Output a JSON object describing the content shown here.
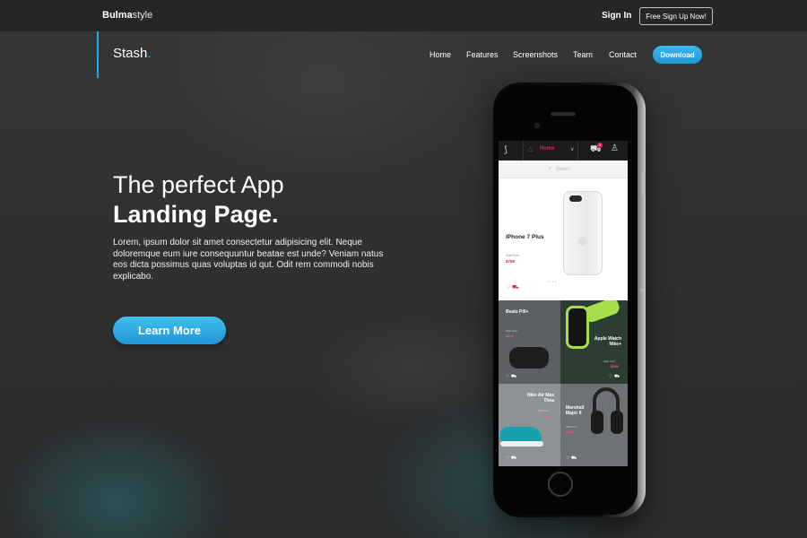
{
  "topbar": {
    "brand_bold": "Bulma",
    "brand_light": "style",
    "signin": "Sign In",
    "signup": "Free Sign Up Now!"
  },
  "nav": {
    "logo": "Stash",
    "logo_dot": ".",
    "links": [
      "Home",
      "Features",
      "Screenshots",
      "Team",
      "Contact"
    ],
    "download": "Download",
    "accent_color": "#27a7e0"
  },
  "hero": {
    "title_line1": "The perfect App",
    "title_line2": "Landing Page.",
    "description": "Lorem, ipsum dolor sit amet consectetur adipisicing elit. Neque doloremque eum iure consequuntur beatae est unde? Veniam natus eos dicta possimus quas voluptas id qut. Odit rem commodi nobis explicabo.",
    "cta": "Learn More",
    "cta_color": "#27a7e0"
  },
  "app": {
    "header": {
      "logo_icon": "s-logo-icon",
      "home_icon": "home-icon",
      "home_label": "Home",
      "chevron_icon": "chevron-down-icon",
      "cart_icon": "cart-icon",
      "cart_badge": "3",
      "user_icon": "user-icon"
    },
    "search_placeholder": "Search",
    "featured": {
      "name": "iPhone 7 Plus",
      "from": "Start from",
      "price": "$799"
    },
    "tiles": [
      {
        "name": "Beats Pill+",
        "from": "Start from",
        "price": "$229"
      },
      {
        "name": "Apple Watch Nike+",
        "from": "Start from",
        "price": "$399"
      },
      {
        "name": "Nike Air Max Thea",
        "from": "Start from",
        "price": "$159"
      },
      {
        "name": "Marshall Major II",
        "from": "Start from",
        "price": "$149"
      }
    ],
    "accent": "#e0245e"
  }
}
